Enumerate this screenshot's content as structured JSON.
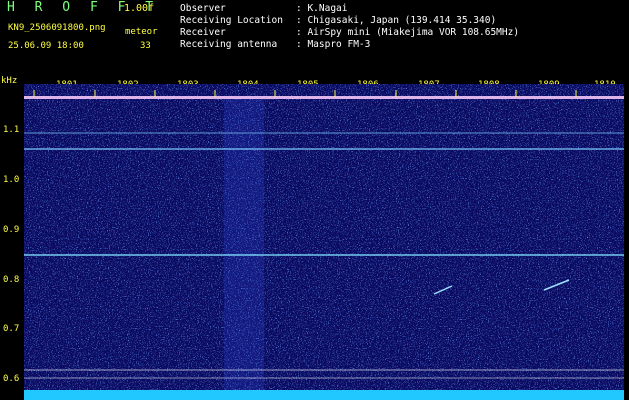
{
  "header": {
    "app_title": "H R O F F T",
    "version": "1.00f",
    "filename": "KN9_2506091800.png",
    "meteor_label": "meteor",
    "datetime": "25.06.09 18:00",
    "meteor_count": "33",
    "info_rows": [
      {
        "label": "Observer",
        "value": ": K.Nagai"
      },
      {
        "label": "Receiving Location",
        "value": ": Chigasaki, Japan (139.414 35.340)"
      },
      {
        "label": "Receiver",
        "value": ": AirSpy mini (Miakejima VOR 108.65MHz)"
      },
      {
        "label": "Receiving antenna",
        "value": ": Maspro FM-3"
      }
    ]
  },
  "spectrogram": {
    "unit": "kHz",
    "time_ticks": [
      "1801",
      "1802",
      "1803",
      "1804",
      "1805",
      "1806",
      "1807",
      "1808",
      "1809",
      "1810"
    ],
    "freq_ticks": [
      "1.1",
      "1.0",
      "0.9",
      "0.8",
      "0.7",
      "0.6"
    ],
    "colors": {
      "background": "#0a0a60",
      "noise": "#3050ff",
      "line": "#7fd0ff",
      "label": "#ffff40"
    }
  }
}
